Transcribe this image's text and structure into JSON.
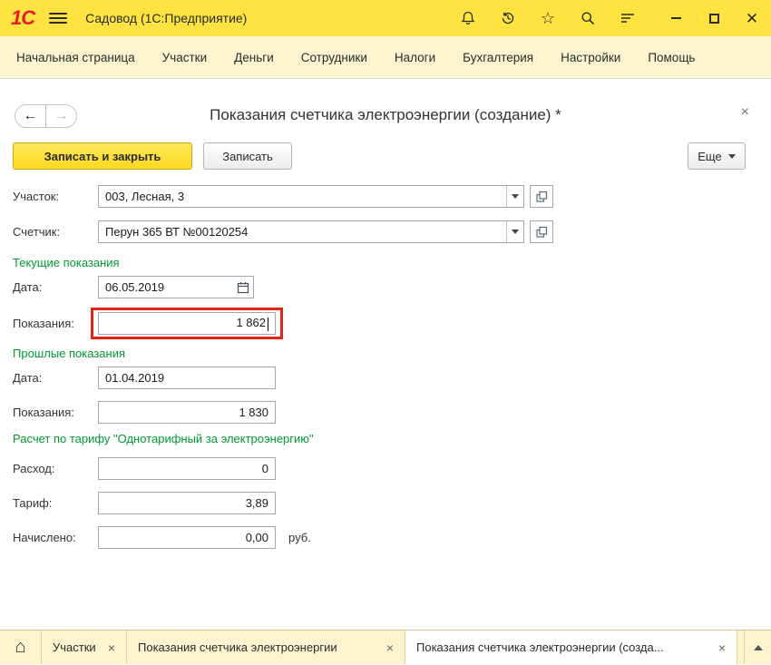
{
  "titlebar": {
    "logo": "1С",
    "title": "Садовод (1С:Предприятие)"
  },
  "menu": {
    "items": [
      "Начальная страница",
      "Участки",
      "Деньги",
      "Сотрудники",
      "Налоги",
      "Бухгалтерия",
      "Настройки",
      "Помощь"
    ]
  },
  "form": {
    "title": "Показания счетчика электроэнергии (создание) *",
    "save_close": "Записать и закрыть",
    "save": "Записать",
    "more": "Еще",
    "rows": {
      "plot": {
        "label": "Участок:",
        "value": "003, Лесная, 3"
      },
      "meter": {
        "label": "Счетчик:",
        "value": "Перун 365 ВТ №00120254"
      },
      "current": {
        "header": "Текущие показания",
        "date_label": "Дата:",
        "date": "06.05.2019",
        "reading_label": "Показания:",
        "reading": "1 862"
      },
      "previous": {
        "header": "Прошлые показания",
        "date_label": "Дата:",
        "date": "01.04.2019",
        "reading_label": "Показания:",
        "reading": "1 830"
      },
      "tariff": {
        "header": "Расчет по тарифу \"Однотарифный за электроэнергию\"",
        "consumption_label": "Расход:",
        "consumption": "0",
        "rate_label": "Тариф:",
        "rate": "3,89",
        "accrued_label": "Начислено:",
        "accrued": "0,00",
        "currency": "руб."
      }
    }
  },
  "tabs": {
    "items": [
      {
        "label": "Участки"
      },
      {
        "label": "Показания счетчика электроэнергии"
      },
      {
        "label": "Показания счетчика электроэнергии (созда...",
        "active": true
      }
    ]
  },
  "glyphs": {
    "star": "☆",
    "back": "←",
    "forward": "→",
    "window_close": "✕",
    "form_close": "×",
    "tab_close": "×",
    "home": "⌂"
  },
  "colors": {
    "accent_yellow": "#ffe341",
    "pale_yellow": "#fbf4cf",
    "section_green": "#009933",
    "focus_red": "#de2517"
  }
}
